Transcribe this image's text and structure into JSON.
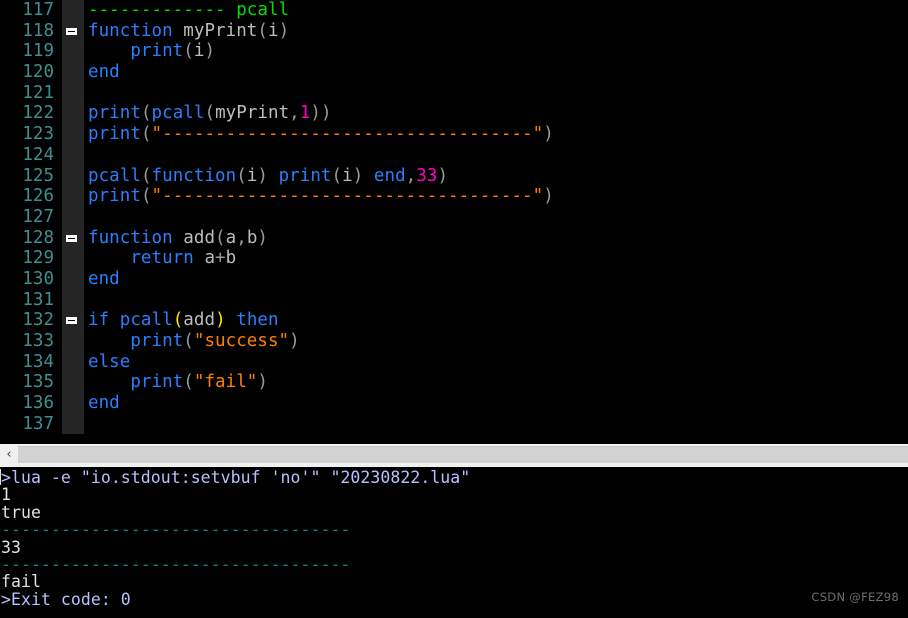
{
  "app": {
    "kind": "lua-code-editor-with-console",
    "theme": {
      "background": "#000000",
      "gutter_background": "#252525",
      "line_number_color": "#3f8f8f",
      "comment_color": "#00e000",
      "keyword_color": "#2a7fff",
      "string_color": "#ff8000",
      "number_color": "#ff00c8",
      "identifier_color": "#bdbdbd",
      "bracket_match_color": "#ffe800",
      "terminal_command_color": "#b9c0ff",
      "terminal_output_color": "#e2e2e2",
      "terminal_separator_color": "#1a7f7f",
      "scrollbar_track_color": "#d2d2d2",
      "scrollbar_face_color": "#f0f0f0"
    }
  },
  "editor": {
    "language": "lua",
    "first_visible_line": 117,
    "last_visible_line": 137,
    "lines": [
      {
        "number": "117",
        "fold": false,
        "tokens": [
          {
            "text": "-------------",
            "cls": "t-comment"
          },
          {
            "text": " pcall",
            "cls": "t-comment"
          }
        ]
      },
      {
        "number": "118",
        "fold": true,
        "tokens": [
          {
            "text": "function",
            "cls": "t-kw"
          },
          {
            "text": " ",
            "cls": "t-plain"
          },
          {
            "text": "myPrint",
            "cls": "t-ident"
          },
          {
            "text": "(",
            "cls": "t-punct"
          },
          {
            "text": "i",
            "cls": "t-ident"
          },
          {
            "text": ")",
            "cls": "t-punct"
          }
        ]
      },
      {
        "number": "119",
        "fold": false,
        "tokens": [
          {
            "text": "    ",
            "cls": "t-plain"
          },
          {
            "text": "print",
            "cls": "t-fn"
          },
          {
            "text": "(",
            "cls": "t-punct"
          },
          {
            "text": "i",
            "cls": "t-ident"
          },
          {
            "text": ")",
            "cls": "t-punct"
          }
        ]
      },
      {
        "number": "120",
        "fold": false,
        "tokens": [
          {
            "text": "end",
            "cls": "t-kw"
          }
        ]
      },
      {
        "number": "121",
        "fold": false,
        "tokens": []
      },
      {
        "number": "122",
        "fold": false,
        "tokens": [
          {
            "text": "print",
            "cls": "t-fn"
          },
          {
            "text": "(",
            "cls": "t-punct"
          },
          {
            "text": "pcall",
            "cls": "t-fn"
          },
          {
            "text": "(",
            "cls": "t-punct"
          },
          {
            "text": "myPrint",
            "cls": "t-ident"
          },
          {
            "text": ",",
            "cls": "t-punct"
          },
          {
            "text": "1",
            "cls": "t-num"
          },
          {
            "text": "))",
            "cls": "t-punct"
          }
        ]
      },
      {
        "number": "123",
        "fold": false,
        "tokens": [
          {
            "text": "print",
            "cls": "t-fn"
          },
          {
            "text": "(",
            "cls": "t-punct"
          },
          {
            "text": "\"-----------------------------------\"",
            "cls": "t-str"
          },
          {
            "text": ")",
            "cls": "t-punct"
          }
        ]
      },
      {
        "number": "124",
        "fold": false,
        "tokens": []
      },
      {
        "number": "125",
        "fold": false,
        "tokens": [
          {
            "text": "pcall",
            "cls": "t-fn"
          },
          {
            "text": "(",
            "cls": "t-punct"
          },
          {
            "text": "function",
            "cls": "t-kw"
          },
          {
            "text": "(",
            "cls": "t-punct"
          },
          {
            "text": "i",
            "cls": "t-ident"
          },
          {
            "text": ")",
            "cls": "t-punct"
          },
          {
            "text": " ",
            "cls": "t-plain"
          },
          {
            "text": "print",
            "cls": "t-fn"
          },
          {
            "text": "(",
            "cls": "t-punct"
          },
          {
            "text": "i",
            "cls": "t-ident"
          },
          {
            "text": ")",
            "cls": "t-punct"
          },
          {
            "text": " ",
            "cls": "t-plain"
          },
          {
            "text": "end",
            "cls": "t-kw"
          },
          {
            "text": ",",
            "cls": "t-punct"
          },
          {
            "text": "33",
            "cls": "t-num"
          },
          {
            "text": ")",
            "cls": "t-punct"
          }
        ]
      },
      {
        "number": "126",
        "fold": false,
        "tokens": [
          {
            "text": "print",
            "cls": "t-fn"
          },
          {
            "text": "(",
            "cls": "t-punct"
          },
          {
            "text": "\"-----------------------------------\"",
            "cls": "t-str"
          },
          {
            "text": ")",
            "cls": "t-punct"
          }
        ]
      },
      {
        "number": "127",
        "fold": false,
        "tokens": []
      },
      {
        "number": "128",
        "fold": true,
        "tokens": [
          {
            "text": "function",
            "cls": "t-kw"
          },
          {
            "text": " ",
            "cls": "t-plain"
          },
          {
            "text": "add",
            "cls": "t-ident"
          },
          {
            "text": "(",
            "cls": "t-punct"
          },
          {
            "text": "a",
            "cls": "t-ident"
          },
          {
            "text": ",",
            "cls": "t-punct"
          },
          {
            "text": "b",
            "cls": "t-ident"
          },
          {
            "text": ")",
            "cls": "t-punct"
          }
        ]
      },
      {
        "number": "129",
        "fold": false,
        "tokens": [
          {
            "text": "    ",
            "cls": "t-plain"
          },
          {
            "text": "return",
            "cls": "t-kw"
          },
          {
            "text": " ",
            "cls": "t-plain"
          },
          {
            "text": "a",
            "cls": "t-ident"
          },
          {
            "text": "+",
            "cls": "t-punct"
          },
          {
            "text": "b",
            "cls": "t-ident"
          }
        ]
      },
      {
        "number": "130",
        "fold": false,
        "tokens": [
          {
            "text": "end",
            "cls": "t-kw"
          }
        ]
      },
      {
        "number": "131",
        "fold": false,
        "tokens": []
      },
      {
        "number": "132",
        "fold": true,
        "tokens": [
          {
            "text": "if",
            "cls": "t-kw"
          },
          {
            "text": " ",
            "cls": "t-plain"
          },
          {
            "text": "pcall",
            "cls": "t-fn"
          },
          {
            "text": "(",
            "cls": "t-brmatch"
          },
          {
            "text": "add",
            "cls": "t-ident"
          },
          {
            "text": ")",
            "cls": "t-brmatch"
          },
          {
            "text": " ",
            "cls": "t-plain"
          },
          {
            "text": "then",
            "cls": "t-kw"
          }
        ]
      },
      {
        "number": "133",
        "fold": false,
        "tokens": [
          {
            "text": "    ",
            "cls": "t-plain"
          },
          {
            "text": "print",
            "cls": "t-fn"
          },
          {
            "text": "(",
            "cls": "t-punct"
          },
          {
            "text": "\"success\"",
            "cls": "t-str"
          },
          {
            "text": ")",
            "cls": "t-punct"
          }
        ]
      },
      {
        "number": "134",
        "fold": false,
        "tokens": [
          {
            "text": "else",
            "cls": "t-kw"
          }
        ]
      },
      {
        "number": "135",
        "fold": false,
        "tokens": [
          {
            "text": "    ",
            "cls": "t-plain"
          },
          {
            "text": "print",
            "cls": "t-fn"
          },
          {
            "text": "(",
            "cls": "t-punct"
          },
          {
            "text": "\"fail\"",
            "cls": "t-str"
          },
          {
            "text": ")",
            "cls": "t-punct"
          }
        ]
      },
      {
        "number": "136",
        "fold": false,
        "tokens": [
          {
            "text": "end",
            "cls": "t-kw"
          }
        ]
      },
      {
        "number": "137",
        "fold": false,
        "tokens": []
      }
    ]
  },
  "scrollbar": {
    "left_arrow_glyph": "‹",
    "orientation": "horizontal"
  },
  "terminal": {
    "lines": [
      {
        "text": ">lua -e \"io.stdout:setvbuf 'no'\" \"20230822.lua\"",
        "cls": "term-cmd"
      },
      {
        "text": "1",
        "cls": "term-out"
      },
      {
        "text": "true",
        "cls": "term-out"
      },
      {
        "text": "-----------------------------------",
        "cls": "term-sep"
      },
      {
        "text": "33",
        "cls": "term-out"
      },
      {
        "text": "-----------------------------------",
        "cls": "term-sep"
      },
      {
        "text": "fail",
        "cls": "term-out"
      },
      {
        "text": ">Exit code: 0",
        "cls": "term-cmd"
      }
    ]
  },
  "watermark": {
    "text": "CSDN @FEZ98"
  }
}
